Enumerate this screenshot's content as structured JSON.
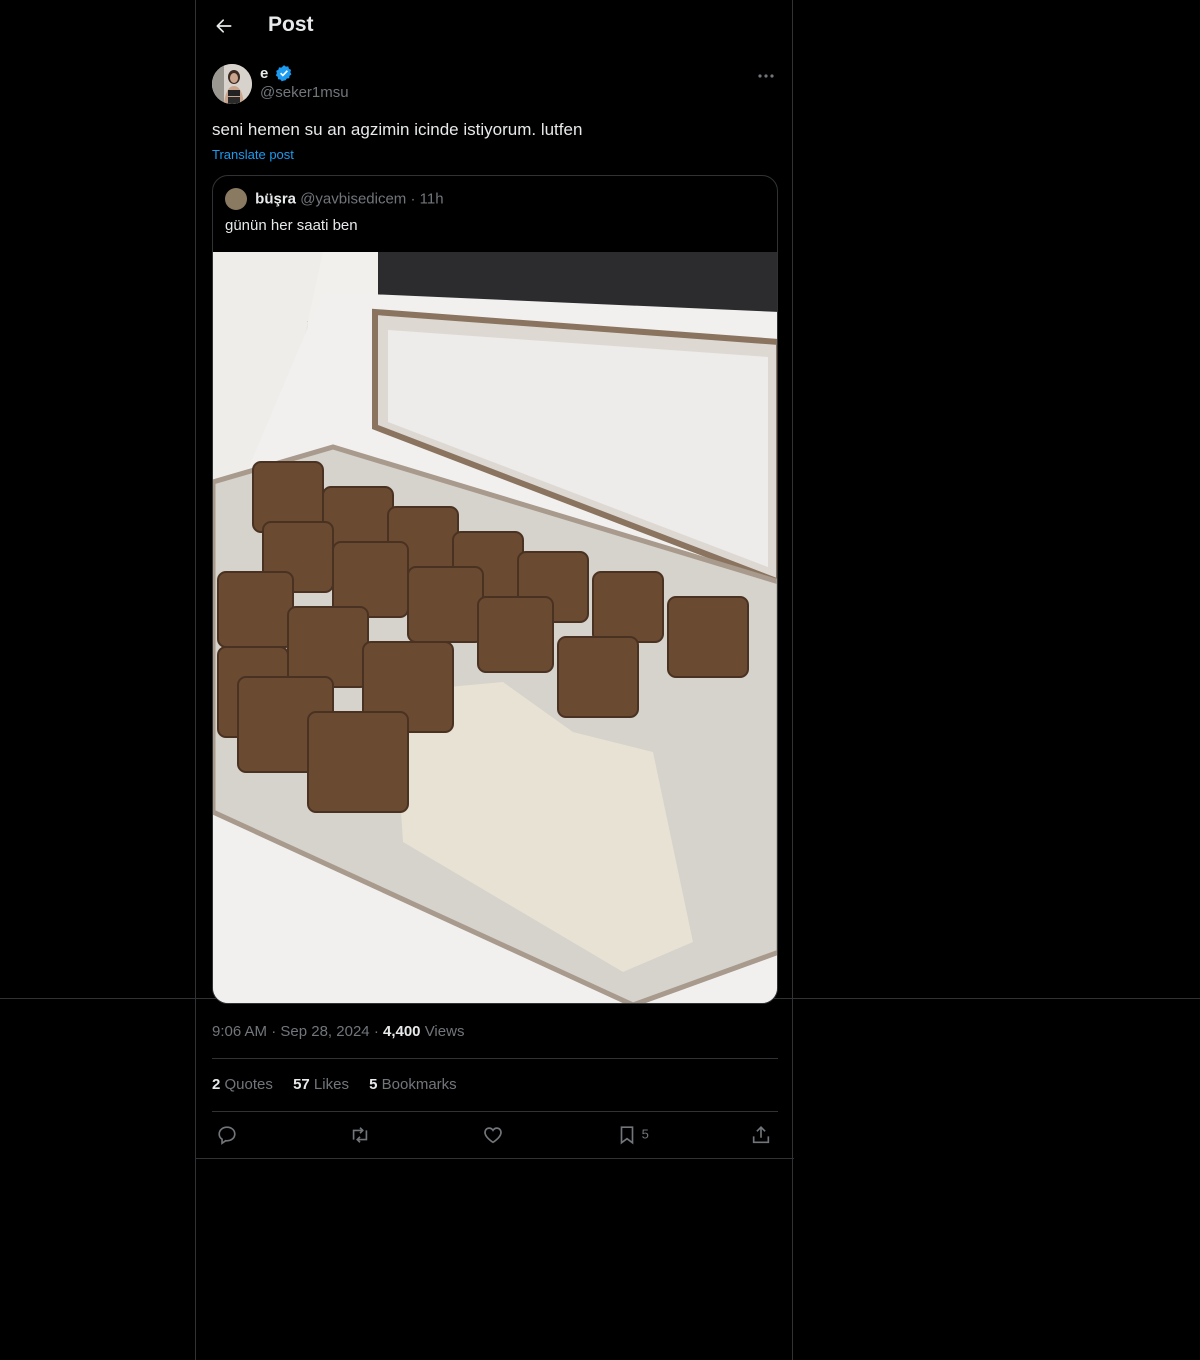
{
  "header": {
    "title": "Post"
  },
  "post": {
    "author_name": "e",
    "author_handle": "@seker1msu",
    "text": "seni hemen su an agzimin icinde istiyorum. lutfen",
    "translate_label": "Translate post",
    "quote": {
      "name": "büşra",
      "handle": "@yavbisedicem",
      "separator": "·",
      "time": "11h",
      "text": "günün her saati ben"
    },
    "meta": {
      "time": "9:06 AM",
      "sep1": "·",
      "date": "Sep 28, 2024",
      "sep2": "·",
      "views_count": "4,400",
      "views_label": "Views"
    },
    "stats": {
      "quotes_count": "2",
      "quotes_label": "Quotes",
      "likes_count": "57",
      "likes_label": "Likes",
      "bookmarks_count": "5",
      "bookmarks_label": "Bookmarks"
    },
    "actions": {
      "bookmark_count": "5"
    }
  },
  "colors": {
    "background": "#000000",
    "accent": "#1d9bf0",
    "border": "#2f3336",
    "muted": "#71767b"
  }
}
